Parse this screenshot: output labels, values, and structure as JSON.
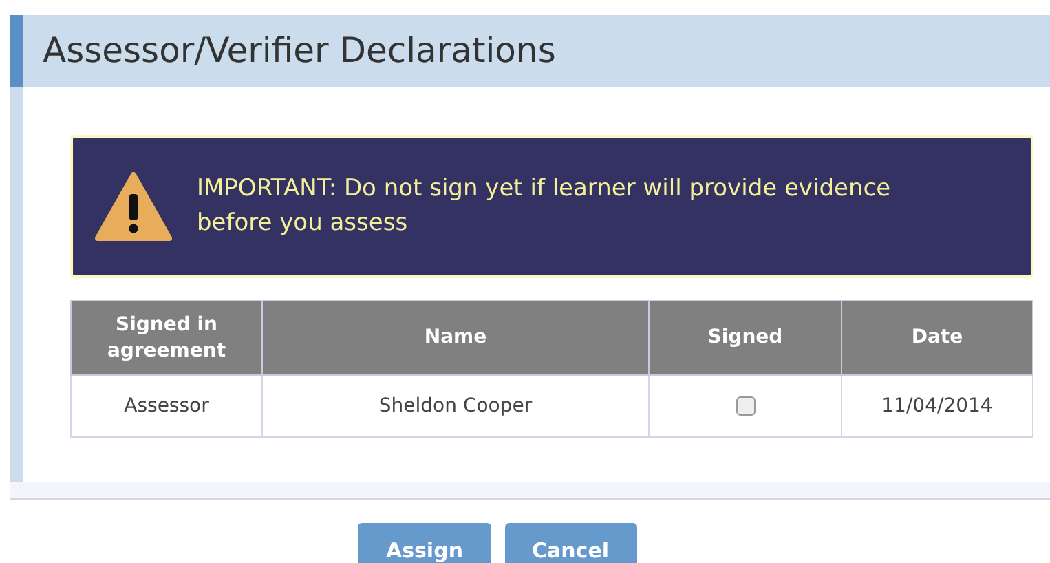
{
  "panel": {
    "title": "Assessor/Verifier Declarations"
  },
  "alert": {
    "text": "IMPORTANT: Do not sign yet if learner will provide evidence before you assess"
  },
  "table": {
    "columns": [
      "Signed in agreement",
      "Name",
      "Signed",
      "Date"
    ],
    "rows": [
      {
        "role": "Assessor",
        "name": "Sheldon Cooper",
        "signed": false,
        "date": "11/04/2014"
      }
    ]
  },
  "buttons": [
    "Assign",
    "Cancel"
  ]
}
